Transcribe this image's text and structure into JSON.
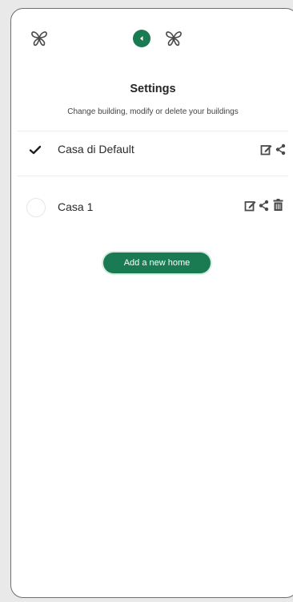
{
  "theme": {
    "accent": "#1a7a52",
    "icon_color": "#4a4a4a"
  },
  "header": {
    "left_icon": "butterfly-logo-icon",
    "back_icon": "back-arrow-icon",
    "center_icon": "butterfly-logo-icon"
  },
  "page": {
    "title": "Settings",
    "subtitle": "Change building, modify or delete your buildings"
  },
  "homes": [
    {
      "name": "Casa di Default",
      "selected": true,
      "actions": [
        "edit-icon",
        "share-icon"
      ]
    },
    {
      "name": "Casa 1",
      "selected": false,
      "actions": [
        "edit-icon",
        "share-icon",
        "trash-icon"
      ]
    }
  ],
  "add_button": {
    "label": "Add a new home"
  }
}
